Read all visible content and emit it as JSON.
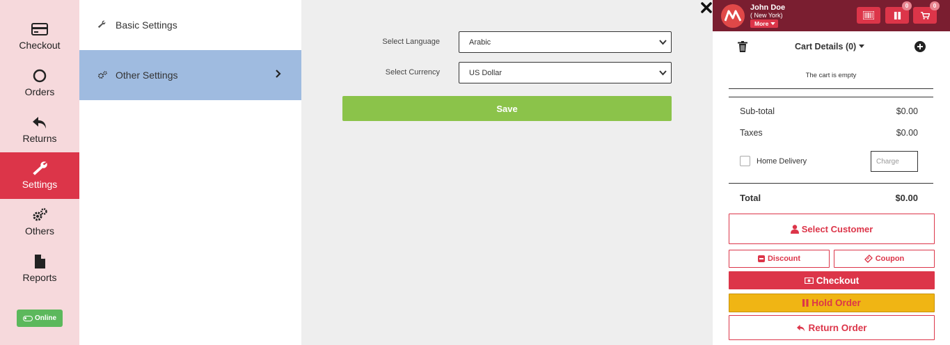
{
  "nav": {
    "items": [
      {
        "label": "Checkout",
        "icon": "credit-card-icon"
      },
      {
        "label": "Orders",
        "icon": "circle-icon"
      },
      {
        "label": "Returns",
        "icon": "reply-icon"
      },
      {
        "label": "Settings",
        "icon": "wrench-icon",
        "active": true
      },
      {
        "label": "Others",
        "icon": "gears-icon"
      },
      {
        "label": "Reports",
        "icon": "file-icon"
      }
    ],
    "status_label": "Online"
  },
  "submenu": {
    "items": [
      {
        "label": "Basic Settings",
        "icon": "wrench-icon"
      },
      {
        "label": "Other Settings",
        "icon": "gears-icon",
        "active": true
      }
    ]
  },
  "form": {
    "language_label": "Select Language",
    "language_value": "Arabic",
    "currency_label": "Select Currency",
    "currency_value": "US Dollar",
    "save_label": "Save"
  },
  "cart": {
    "user_name": "John Doe",
    "user_location": "( New York)",
    "more_label": "More",
    "barcode_count": "0",
    "cart_count": "0",
    "title": "Cart Details (0)",
    "empty_message": "The cart is empty",
    "subtotal_label": "Sub-total",
    "subtotal_value": "$0.00",
    "taxes_label": "Taxes",
    "taxes_value": "$0.00",
    "home_delivery_label": "Home Delivery",
    "charge_placeholder": "Charge",
    "total_label": "Total",
    "total_value": "$0.00"
  },
  "actions": {
    "select_customer": "Select Customer",
    "discount": "Discount",
    "coupon": "Coupon",
    "checkout": "Checkout",
    "hold_order": "Hold Order",
    "return_order": "Return Order"
  },
  "colors": {
    "accent": "#dc3549",
    "header": "#7a1e30",
    "save": "#8bc34a",
    "hold": "#f0b514",
    "online": "#5cb85c",
    "submenu_active": "#9fbbe0",
    "nav_bg": "#f6d9dc"
  }
}
